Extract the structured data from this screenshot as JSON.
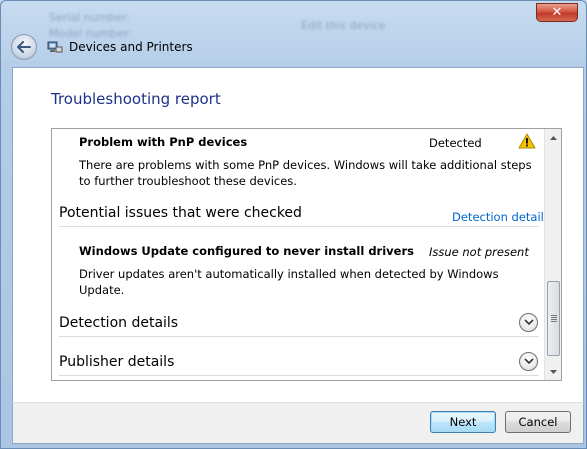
{
  "window": {
    "close_label": "✕",
    "breadcrumb": "Devices and Printers",
    "background_faint": [
      "Serial number:",
      "Model number:",
      "Edit this device"
    ]
  },
  "page": {
    "title": "Troubleshooting report"
  },
  "report": {
    "problem": {
      "title": "Problem with PnP devices",
      "status": "Detected",
      "description_line1": "There are problems with some PnP devices. Windows will take additional steps",
      "description_line2": "to further troubleshoot these devices."
    },
    "checked_section": {
      "heading": "Potential issues that were checked",
      "link": "Detection details"
    },
    "issue": {
      "title": "Windows Update configured to never install drivers",
      "status": "Issue not present",
      "description_line1": "Driver updates aren't automatically installed when detected by Windows",
      "description_line2": "Update."
    },
    "detection_details": {
      "heading": "Detection details"
    },
    "publisher_details": {
      "heading": "Publisher details"
    }
  },
  "footer": {
    "next_label": "Next",
    "cancel_label": "Cancel"
  },
  "colors": {
    "title_blue": "#1e3287",
    "link_blue": "#0066cc",
    "warning_yellow": "#f5c400"
  }
}
